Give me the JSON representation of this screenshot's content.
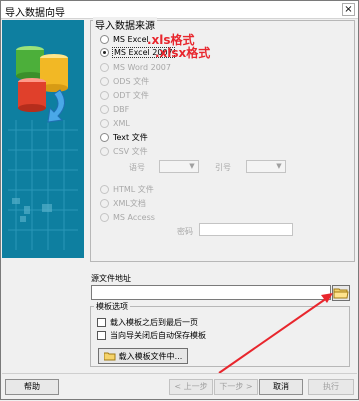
{
  "window": {
    "title": "导入数据向导",
    "close_symbol": "×"
  },
  "source_group": {
    "title": "导入数据来源",
    "options": [
      {
        "label": "MS Excel",
        "checked": false,
        "disabled": false
      },
      {
        "label": "MS Excel 2007",
        "checked": true,
        "disabled": false
      },
      {
        "label": "MS Word 2007",
        "checked": false,
        "disabled": true
      },
      {
        "label": "ODS 文件",
        "checked": false,
        "disabled": true
      },
      {
        "label": "ODT 文件",
        "checked": false,
        "disabled": true
      },
      {
        "label": "DBF",
        "checked": false,
        "disabled": true
      },
      {
        "label": "XML",
        "checked": false,
        "disabled": true
      },
      {
        "label": "Text 文件",
        "checked": false,
        "disabled": false
      },
      {
        "label": "CSV 文件",
        "checked": false,
        "disabled": true
      },
      {
        "label": "HTML 文件",
        "checked": false,
        "disabled": true
      },
      {
        "label": "XML文档",
        "checked": false,
        "disabled": true
      },
      {
        "label": "MS Access",
        "checked": false,
        "disabled": true
      }
    ],
    "annotations": {
      "xls": ".xls格式",
      "xlsx": ".xlsx格式"
    },
    "separator_label": "语号",
    "quote_label": "引号",
    "password_label": "密码"
  },
  "source_file": {
    "label": "源文件地址",
    "value": ""
  },
  "template_group": {
    "title": "模板选项",
    "checkbox1": "载入模板之后到最后一页",
    "checkbox2": "当向导关闭后自动保存模板",
    "load_button": "载入模板文件中..."
  },
  "footer": {
    "help": "帮助",
    "prev": "< 上一步",
    "next": "下一步 >",
    "cancel": "取消",
    "execute": "执行"
  },
  "colors": {
    "annotation_red": "#e8262d",
    "side_panel": "#0e7fa0"
  }
}
